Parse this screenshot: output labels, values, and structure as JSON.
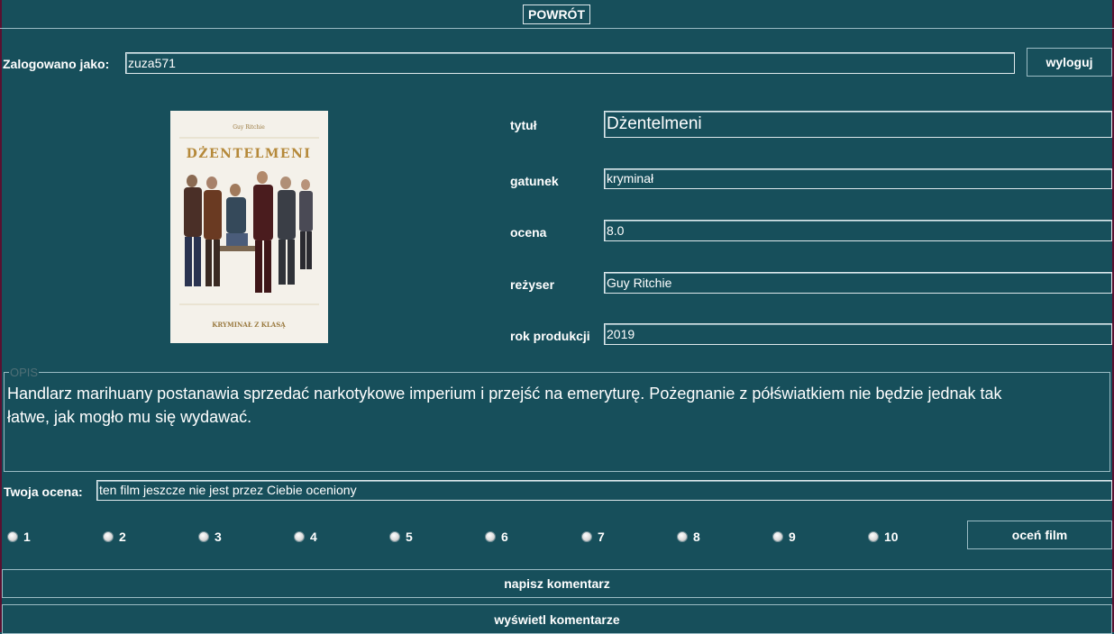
{
  "top": {
    "back_label": "POWRÓT"
  },
  "session": {
    "logged_label": "Zalogowano jako:",
    "username": "zuza571",
    "logout_label": "wyloguj"
  },
  "poster": {
    "presenter": "Guy Ritchie",
    "title": "DŻENTELMENI",
    "tagline": "KRYMINAŁ Z KLASĄ"
  },
  "details": {
    "title_label": "tytuł",
    "title_value": "Dżentelmeni",
    "genre_label": "gatunek",
    "genre_value": "kryminał",
    "rating_label": "ocena",
    "rating_value": "8.0",
    "director_label": "reżyser",
    "director_value": "Guy Ritchie",
    "year_label": "rok produkcji",
    "year_value": "2019"
  },
  "description": {
    "legend": "OPIS",
    "text": "Handlarz marihuany postanawia sprzedać narkotykowe imperium i przejść na emeryturę. Pożegnanie z półświatkiem nie będzie jednak tak łatwe, jak mogło mu się wydawać."
  },
  "user_rating": {
    "label": "Twoja ocena:",
    "value": "ten film jeszcze nie jest przez Ciebie oceniony",
    "options": [
      "1",
      "2",
      "3",
      "4",
      "5",
      "6",
      "7",
      "8",
      "9",
      "10"
    ],
    "rate_label": "oceń film"
  },
  "comments": {
    "write_label": "napisz komentarz",
    "show_label": "wyświetl komentarze"
  }
}
